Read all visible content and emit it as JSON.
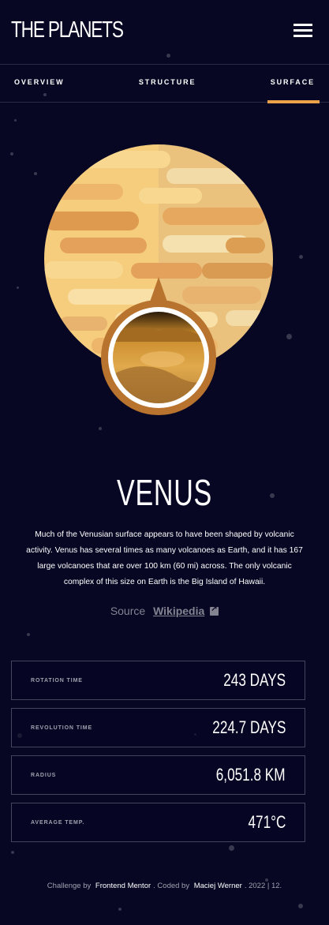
{
  "header": {
    "logo": "THE PLANETS",
    "menu_icon": "hamburger-menu-icon"
  },
  "tabs": [
    {
      "label": "OVERVIEW",
      "active": false
    },
    {
      "label": "STRUCTURE",
      "active": false
    },
    {
      "label": "SURFACE",
      "active": true
    }
  ],
  "planet": {
    "name": "VENUS",
    "description": "Much of the Venusian surface appears to have been shaped by volcanic activity. Venus has several times as many volcanoes as Earth, and it has 167 large volcanoes that are over 100 km (60 mi) across. The only volcanic complex of this size on Earth is the Big Island of Hawaii.",
    "source_label": "Source",
    "source_link": "Wikipedia",
    "source_icon": "external-link-icon"
  },
  "stats": [
    {
      "label": "ROTATION TIME",
      "value": "243 DAYS"
    },
    {
      "label": "REVOLUTION TIME",
      "value": "224.7 DAYS"
    },
    {
      "label": "RADIUS",
      "value": "6,051.8 KM"
    },
    {
      "label": "AVERAGE TEMP.",
      "value": "471°C"
    }
  ],
  "footer": {
    "prefix": "Challenge by",
    "link1": "Frontend Mentor",
    "middle": ". Coded by",
    "link2": "Maciej Werner",
    "suffix": ". 2022 | 12."
  },
  "colors": {
    "background": "#070724",
    "accent": "#EDA249",
    "border": "#38384F"
  }
}
